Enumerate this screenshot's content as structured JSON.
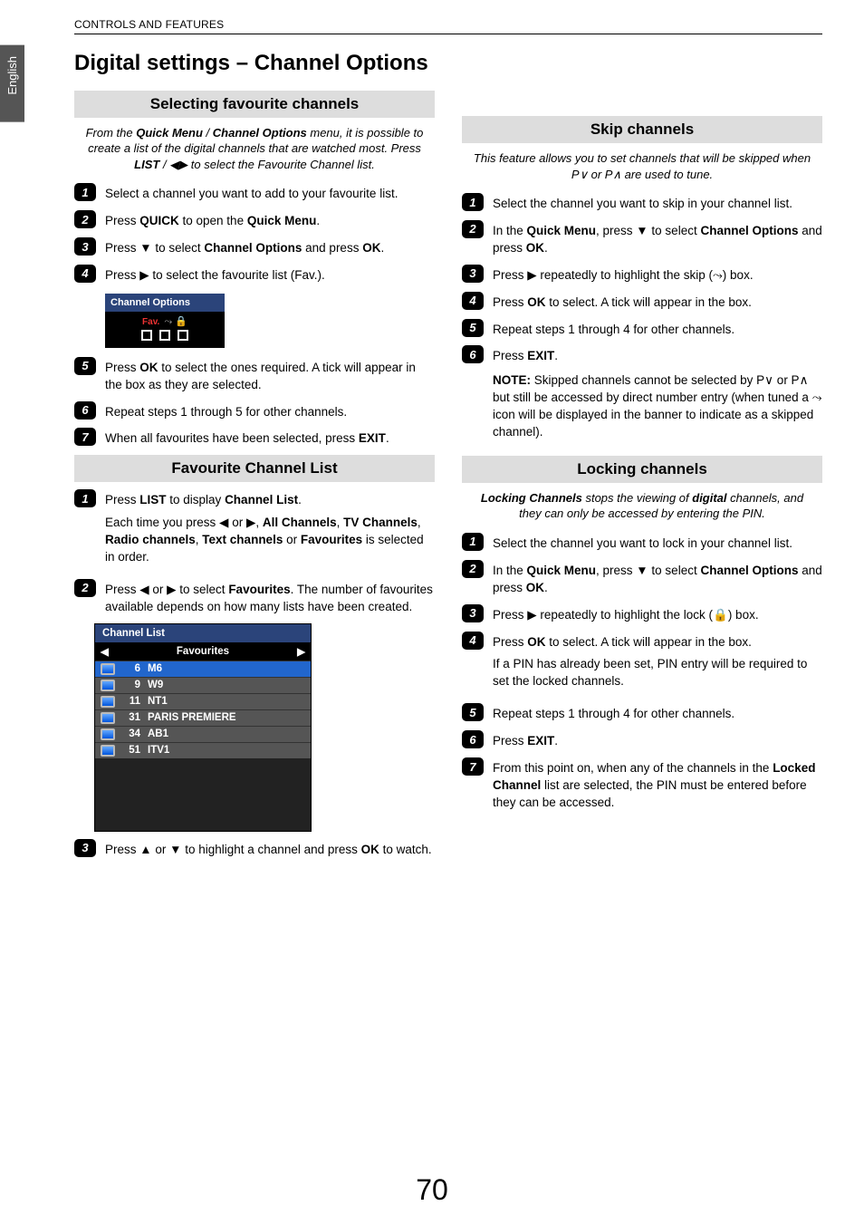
{
  "lang": "English",
  "header": "CONTROLS AND FEATURES",
  "pageNum": "70",
  "left": {
    "title": "Digital settings – Channel Options",
    "sec1": {
      "title": "Selecting favourite channels",
      "intro_pre": "From the ",
      "intro_b1": "Quick Menu",
      "intro_mid1": " / ",
      "intro_b2": "Channel Options",
      "intro_mid2": " menu, it is possible to create a list of the digital channels that are watched most. Press ",
      "intro_b3": "LIST",
      "intro_end": " / ◀▶ to select the Favourite Channel list.",
      "s1": "Select a channel you want to add to your favourite list.",
      "s2a": "Press ",
      "s2b": "QUICK",
      "s2c": " to open the ",
      "s2d": "Quick Menu",
      "s2e": ".",
      "s3a": "Press ▼ to select ",
      "s3b": "Channel Options",
      "s3c": " and press ",
      "s3d": "OK",
      "s3e": ".",
      "s4": "Press ▶ to select the favourite list (Fav.).",
      "chopt_title": "Channel Options",
      "fav_label": "Fav.",
      "s5a": "Press ",
      "s5b": "OK",
      "s5c": " to select the ones required. A tick will appear in the box as they are selected.",
      "s6": "Repeat steps 1 through 5 for other channels.",
      "s7a": "When all favourites have been selected, press ",
      "s7b": "EXIT",
      "s7c": "."
    },
    "sec2": {
      "title": "Favourite Channel List",
      "s1a": "Press ",
      "s1b": "LIST",
      "s1c": " to display ",
      "s1d": "Channel List",
      "s1e": ".",
      "s1p2a": "Each time you press ◀ or ▶, ",
      "s1p2b": "All Channels",
      "s1p2c": ", ",
      "s1p2d": "TV Channels",
      "s1p2e": ", ",
      "s1p2f": "Radio channels",
      "s1p2g": ", ",
      "s1p2h": "Text channels",
      "s1p2i": " or ",
      "s1p2j": "Favourites",
      "s1p2k": " is selected in order.",
      "s2a": "Press ◀ or ▶ to select ",
      "s2b": "Favourites",
      "s2c": ". The number of favourites available depends on how many lists have been created.",
      "chlist_title": "Channel List",
      "chlist_sub": "Favourites",
      "rows": [
        {
          "num": "6",
          "name": "M6"
        },
        {
          "num": "9",
          "name": "W9"
        },
        {
          "num": "11",
          "name": "NT1"
        },
        {
          "num": "31",
          "name": "PARIS PREMIERE"
        },
        {
          "num": "34",
          "name": "AB1"
        },
        {
          "num": "51",
          "name": "ITV1"
        }
      ],
      "s3a": "Press ▲ or ▼ to highlight a channel and press ",
      "s3b": "OK",
      "s3c": " to watch."
    }
  },
  "right": {
    "sec1": {
      "title": "Skip channels",
      "intro": "This feature allows you to set channels that will be skipped when P∨ or P∧ are used to tune.",
      "s1": "Select the channel you want to skip in your channel list.",
      "s2a": "In the ",
      "s2b": "Quick Menu",
      "s2c": ", press ▼ to select ",
      "s2d": "Channel Options",
      "s2e": " and press ",
      "s2f": "OK",
      "s2g": ".",
      "s3": "Press ▶ repeatedly to highlight the skip (⤳) box.",
      "s4a": "Press ",
      "s4b": "OK",
      "s4c": " to select. A tick will appear in the box.",
      "s5": "Repeat steps 1 through 4 for other channels.",
      "s6a": "Press ",
      "s6b": "EXIT",
      "s6c": ".",
      "note_a": "NOTE:",
      "note_b": " Skipped channels cannot be selected by P∨ or P∧ but still be accessed by direct number entry (when tuned a ⤳ icon will be displayed in the banner to indicate as a skipped channel)."
    },
    "sec2": {
      "title": "Locking channels",
      "intro_a": "Locking Channels",
      "intro_b": " stops the viewing of ",
      "intro_c": "digital",
      "intro_d": " channels, and they can only be accessed by entering the PIN.",
      "s1": "Select the channel you want to lock in your channel list.",
      "s2a": "In the ",
      "s2b": "Quick Menu",
      "s2c": ", press ▼ to select ",
      "s2d": "Channel Options",
      "s2e": " and press ",
      "s2f": "OK",
      "s2g": ".",
      "s3": "Press ▶ repeatedly to highlight the lock (🔒) box.",
      "s4a": "Press ",
      "s4b": "OK",
      "s4c": " to select. A tick will appear in the box.",
      "s4p2": "If a PIN has already been set, PIN entry will be required to set the locked channels.",
      "s5": "Repeat steps 1 through 4 for other channels.",
      "s6a": "Press ",
      "s6b": "EXIT",
      "s6c": ".",
      "s7a": "From this point on, when any of the channels in the ",
      "s7b": "Locked Channel",
      "s7c": " list are selected, the PIN must be entered before they can be accessed."
    }
  }
}
